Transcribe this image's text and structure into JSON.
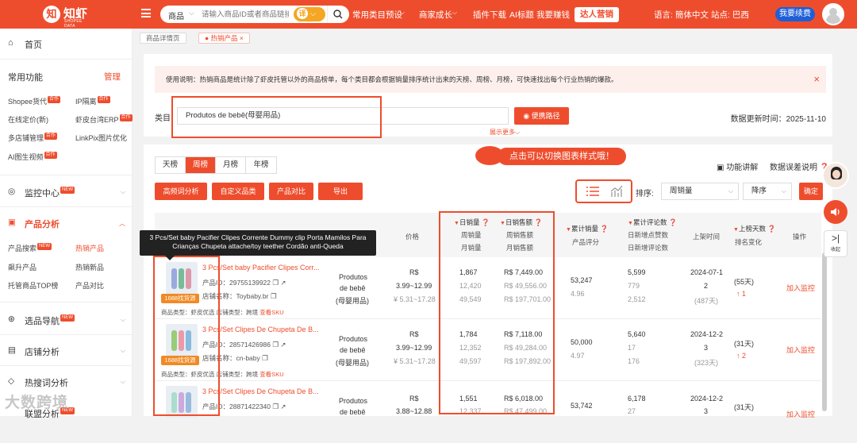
{
  "header": {
    "logo_mark": "知",
    "logo_name": "知虾",
    "logo_sub": "SHOPEE DATA",
    "search_scope": "商品",
    "search_placeholder": "请输入商品ID或者商品链接",
    "translate_label": "译",
    "nav": [
      "常用类目预设",
      "商家成长",
      "插件下载",
      "AI标题",
      "我要赚钱"
    ],
    "promo_button": "达人营销",
    "language": "语言: 簡体中文",
    "site": "站点: 巴西",
    "renew_button": "我要续费"
  },
  "sidebar": {
    "home": "首页",
    "common_title": "常用功能",
    "manage": "管理",
    "common_items": [
      {
        "label": "Shopee货代",
        "tag": "合作"
      },
      {
        "label": "IP隔离",
        "tag": "合作"
      },
      {
        "label": "在线定价(新)",
        "tag": ""
      },
      {
        "label": "虾皮台湾ERP",
        "tag": "合作"
      },
      {
        "label": "多店铺管理",
        "tag": "合作"
      },
      {
        "label": "LinkPix图片优化",
        "tag": ""
      },
      {
        "label": "AI图生视频",
        "tag": "合作"
      }
    ],
    "monitor": "监控中心",
    "product_analysis": "产品分析",
    "pa_items": [
      "产品搜索",
      "热销产品",
      "飙升产品",
      "热销新品",
      "托管商品TOP榜",
      "产品对比"
    ],
    "category_nav": "选品导航",
    "shop_analysis": "店铺分析",
    "hotword": "热搜词分析",
    "affiliate": "联盟分析",
    "new_badge": "NEW"
  },
  "page_tabs": [
    "商品详情页",
    "热销产品"
  ],
  "notice": {
    "text": "使用说明：热销商品是统计除了虾皮托管以外的商品榜单，每个类目都会根据销量排序统计出来的天榜、周榜、月榜，可快速找出每个行业热销的爆款。",
    "close": "×"
  },
  "filter": {
    "category_label": "类目",
    "category_value": "Produtos de bebê(母婴用品)",
    "path_button": "便携路径",
    "more": "展示更多",
    "update_time": "数据更新时间：2025-11-10"
  },
  "controls": {
    "periods": [
      "天榜",
      "周榜",
      "月榜",
      "年榜"
    ],
    "active_period": "周榜",
    "actions": [
      "高频词分析",
      "自定义品类",
      "产品对比",
      "导出"
    ],
    "tip": "点击可以切换图表样式哦！",
    "feature": "功能讲解",
    "error": "数据误差说明",
    "sort_label": "排序:",
    "sort_by": "周销量",
    "sort_order": "降序",
    "confirm": "确定"
  },
  "table": {
    "headers": {
      "price": "价格",
      "daily": "日销量",
      "daily_amount": "日销售额",
      "weekly": "周销量",
      "weekly_amount": "周销售额",
      "monthly": "月销量",
      "monthly_amount": "月销售额",
      "total_sales": "累计销量",
      "rating": "产品评分",
      "total_reviews": "累计评论数",
      "daily_reviews": "日新增点赞数",
      "daily_review_new": "日新增评论数",
      "launch": "上架时间",
      "days_listed": "上榜天数",
      "rank_change": "排名变化",
      "op": "操作"
    },
    "id_label": "产品ID：",
    "shop_label": "店铺名称：",
    "type_label": "商品类型：",
    "tag_1688": "1688找货源",
    "monitor": "加入监控",
    "rows": [
      {
        "title": "3 Pcs/Set baby Pacifier Clipes Corr...",
        "id": "29755139922",
        "shop": "Toybaby.br",
        "type": "虾皮优选",
        "logistics": "跨境",
        "view_sku": "查看SKU",
        "category": [
          "Produtos",
          "de bebê",
          "(母婴用品)"
        ],
        "price_cur": "R$",
        "price_range": "3.99~12.99",
        "price_cny": "¥ 5.31~17.28",
        "daily": "1,867",
        "weekly": "12,420",
        "monthly": "49,549",
        "daily_amt": "R$ 7,449.00",
        "weekly_amt": "R$ 49,556.00",
        "monthly_amt": "R$ 197,701.00",
        "total_sales": "53,247",
        "rating": "4.96",
        "total_reviews": "5,599",
        "d_likes": "779",
        "d_reviews": "2,512",
        "launch_a": "2024-07-1",
        "launch_b": "2",
        "launch_days": "(487天)",
        "listed": "(55天)",
        "rank": "1"
      },
      {
        "title": "3 Pcs/Set Clipes De Chupeta De B...",
        "id": "28571426986",
        "shop": "cn-baby",
        "type": "虾皮优选",
        "logistics": "跨境",
        "view_sku": "查看SKU",
        "category": [
          "Produtos",
          "de bebê",
          "(母婴用品)"
        ],
        "price_cur": "R$",
        "price_range": "3.99~12.99",
        "price_cny": "¥ 5.31~17.28",
        "daily": "1,784",
        "weekly": "12,352",
        "monthly": "49,597",
        "daily_amt": "R$ 7,118.00",
        "weekly_amt": "R$ 49,284.00",
        "monthly_amt": "R$ 197,892.00",
        "total_sales": "50,000",
        "rating": "4.97",
        "total_reviews": "5,640",
        "d_likes": "17",
        "d_reviews": "176",
        "launch_a": "2024-12-2",
        "launch_b": "3",
        "launch_days": "(323天)",
        "listed": "(31天)",
        "rank": "2"
      },
      {
        "title": "3 Pcs/Set Clipes De Chupeta De B...",
        "id": "28871422340",
        "category": [
          "Produtos",
          "de bebê"
        ],
        "price_cur": "R$",
        "price_range": "3.88~12.88",
        "daily": "1,551",
        "weekly": "12,337",
        "daily_amt": "R$ 6,018.00",
        "weekly_amt": "R$ 47,499.00",
        "total_sales": "53,742",
        "total_reviews": "6,178",
        "d_likes": "27",
        "launch_a": "2024-12-2",
        "launch_b": "3",
        "listed": "(31天)"
      }
    ]
  },
  "tooltip": {
    "line1": "3 Pcs/Set baby Pacifier Clipes Corrente Dummy clip Porta Mamilos Para",
    "line2": "Crianças Chupeta attache/toy teether Cordão anti-Queda"
  },
  "float_panel": {
    "collapse": "收起"
  },
  "watermark": "大数跨境",
  "colors": {
    "brand": "#ee4d2d",
    "accent_blue": "#1e5fd8",
    "tag_orange": "#f08a24"
  }
}
